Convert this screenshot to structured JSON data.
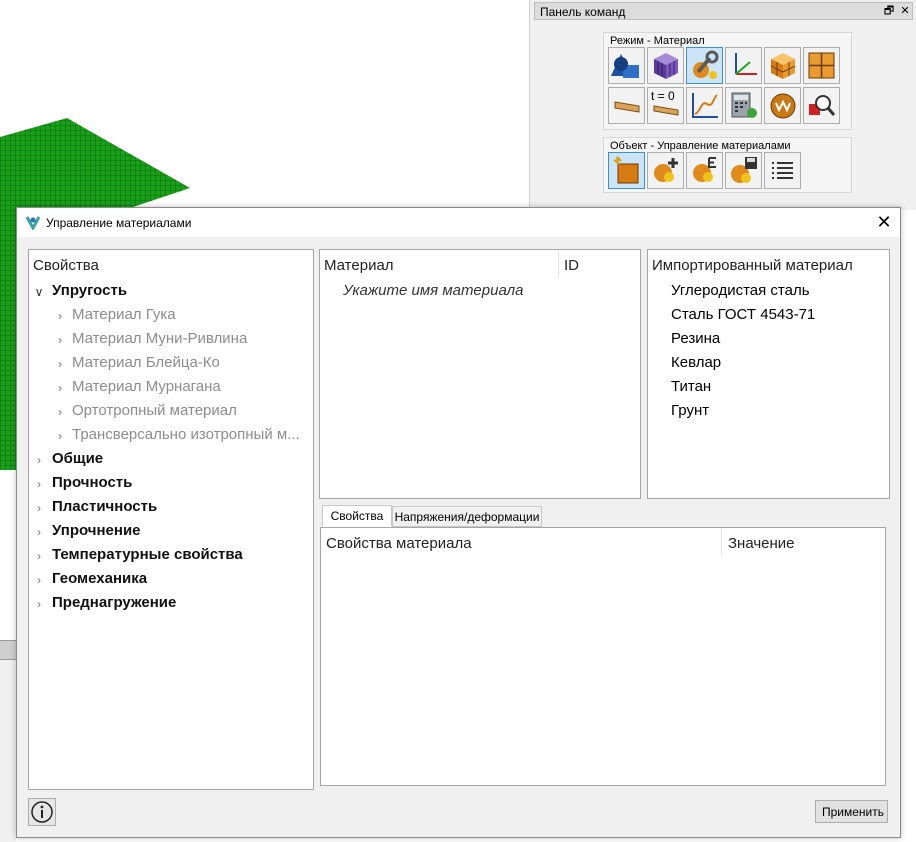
{
  "command_panel": {
    "title": "Панель команд",
    "mode_group": {
      "label": "Режим - Материал"
    },
    "object_group": {
      "label": "Объект - Управление материалами"
    },
    "t0_label": "t = 0"
  },
  "dialog": {
    "title": "Управление материалами",
    "properties_tree": {
      "header": "Свойства",
      "items": [
        {
          "label": "Упругость",
          "expanded": true,
          "children": [
            "Материал Гука",
            "Материал Муни-Ривлина",
            "Материал Блейца-Ко",
            "Материал Мурнагана",
            "Ортотропный материал",
            "Трансверсально изотропный м..."
          ]
        },
        {
          "label": "Общие"
        },
        {
          "label": "Прочность"
        },
        {
          "label": "Пластичность"
        },
        {
          "label": "Упрочнение"
        },
        {
          "label": "Температурные свойства"
        },
        {
          "label": "Геомеханика"
        },
        {
          "label": "Преднагружение"
        }
      ]
    },
    "material_table": {
      "col_material": "Материал",
      "col_id": "ID",
      "placeholder": "Укажите имя материала"
    },
    "imported": {
      "header": "Импортированный материал",
      "items": [
        "Углеродистая сталь",
        "Сталь ГОСТ 4543-71",
        "Резина",
        "Кевлар",
        "Титан",
        "Грунт"
      ]
    },
    "tabs": [
      {
        "label": "Свойства",
        "active": true
      },
      {
        "label": "Напряжения/деформации",
        "active": false
      }
    ],
    "props_table": {
      "col_property": "Свойства материала",
      "col_value": "Значение"
    },
    "apply_label": "Применить"
  },
  "colors": {
    "mesh_green": "#1a9e1a",
    "active_blue": "#cce4f7",
    "accent_blue": "#3a8fd6"
  }
}
